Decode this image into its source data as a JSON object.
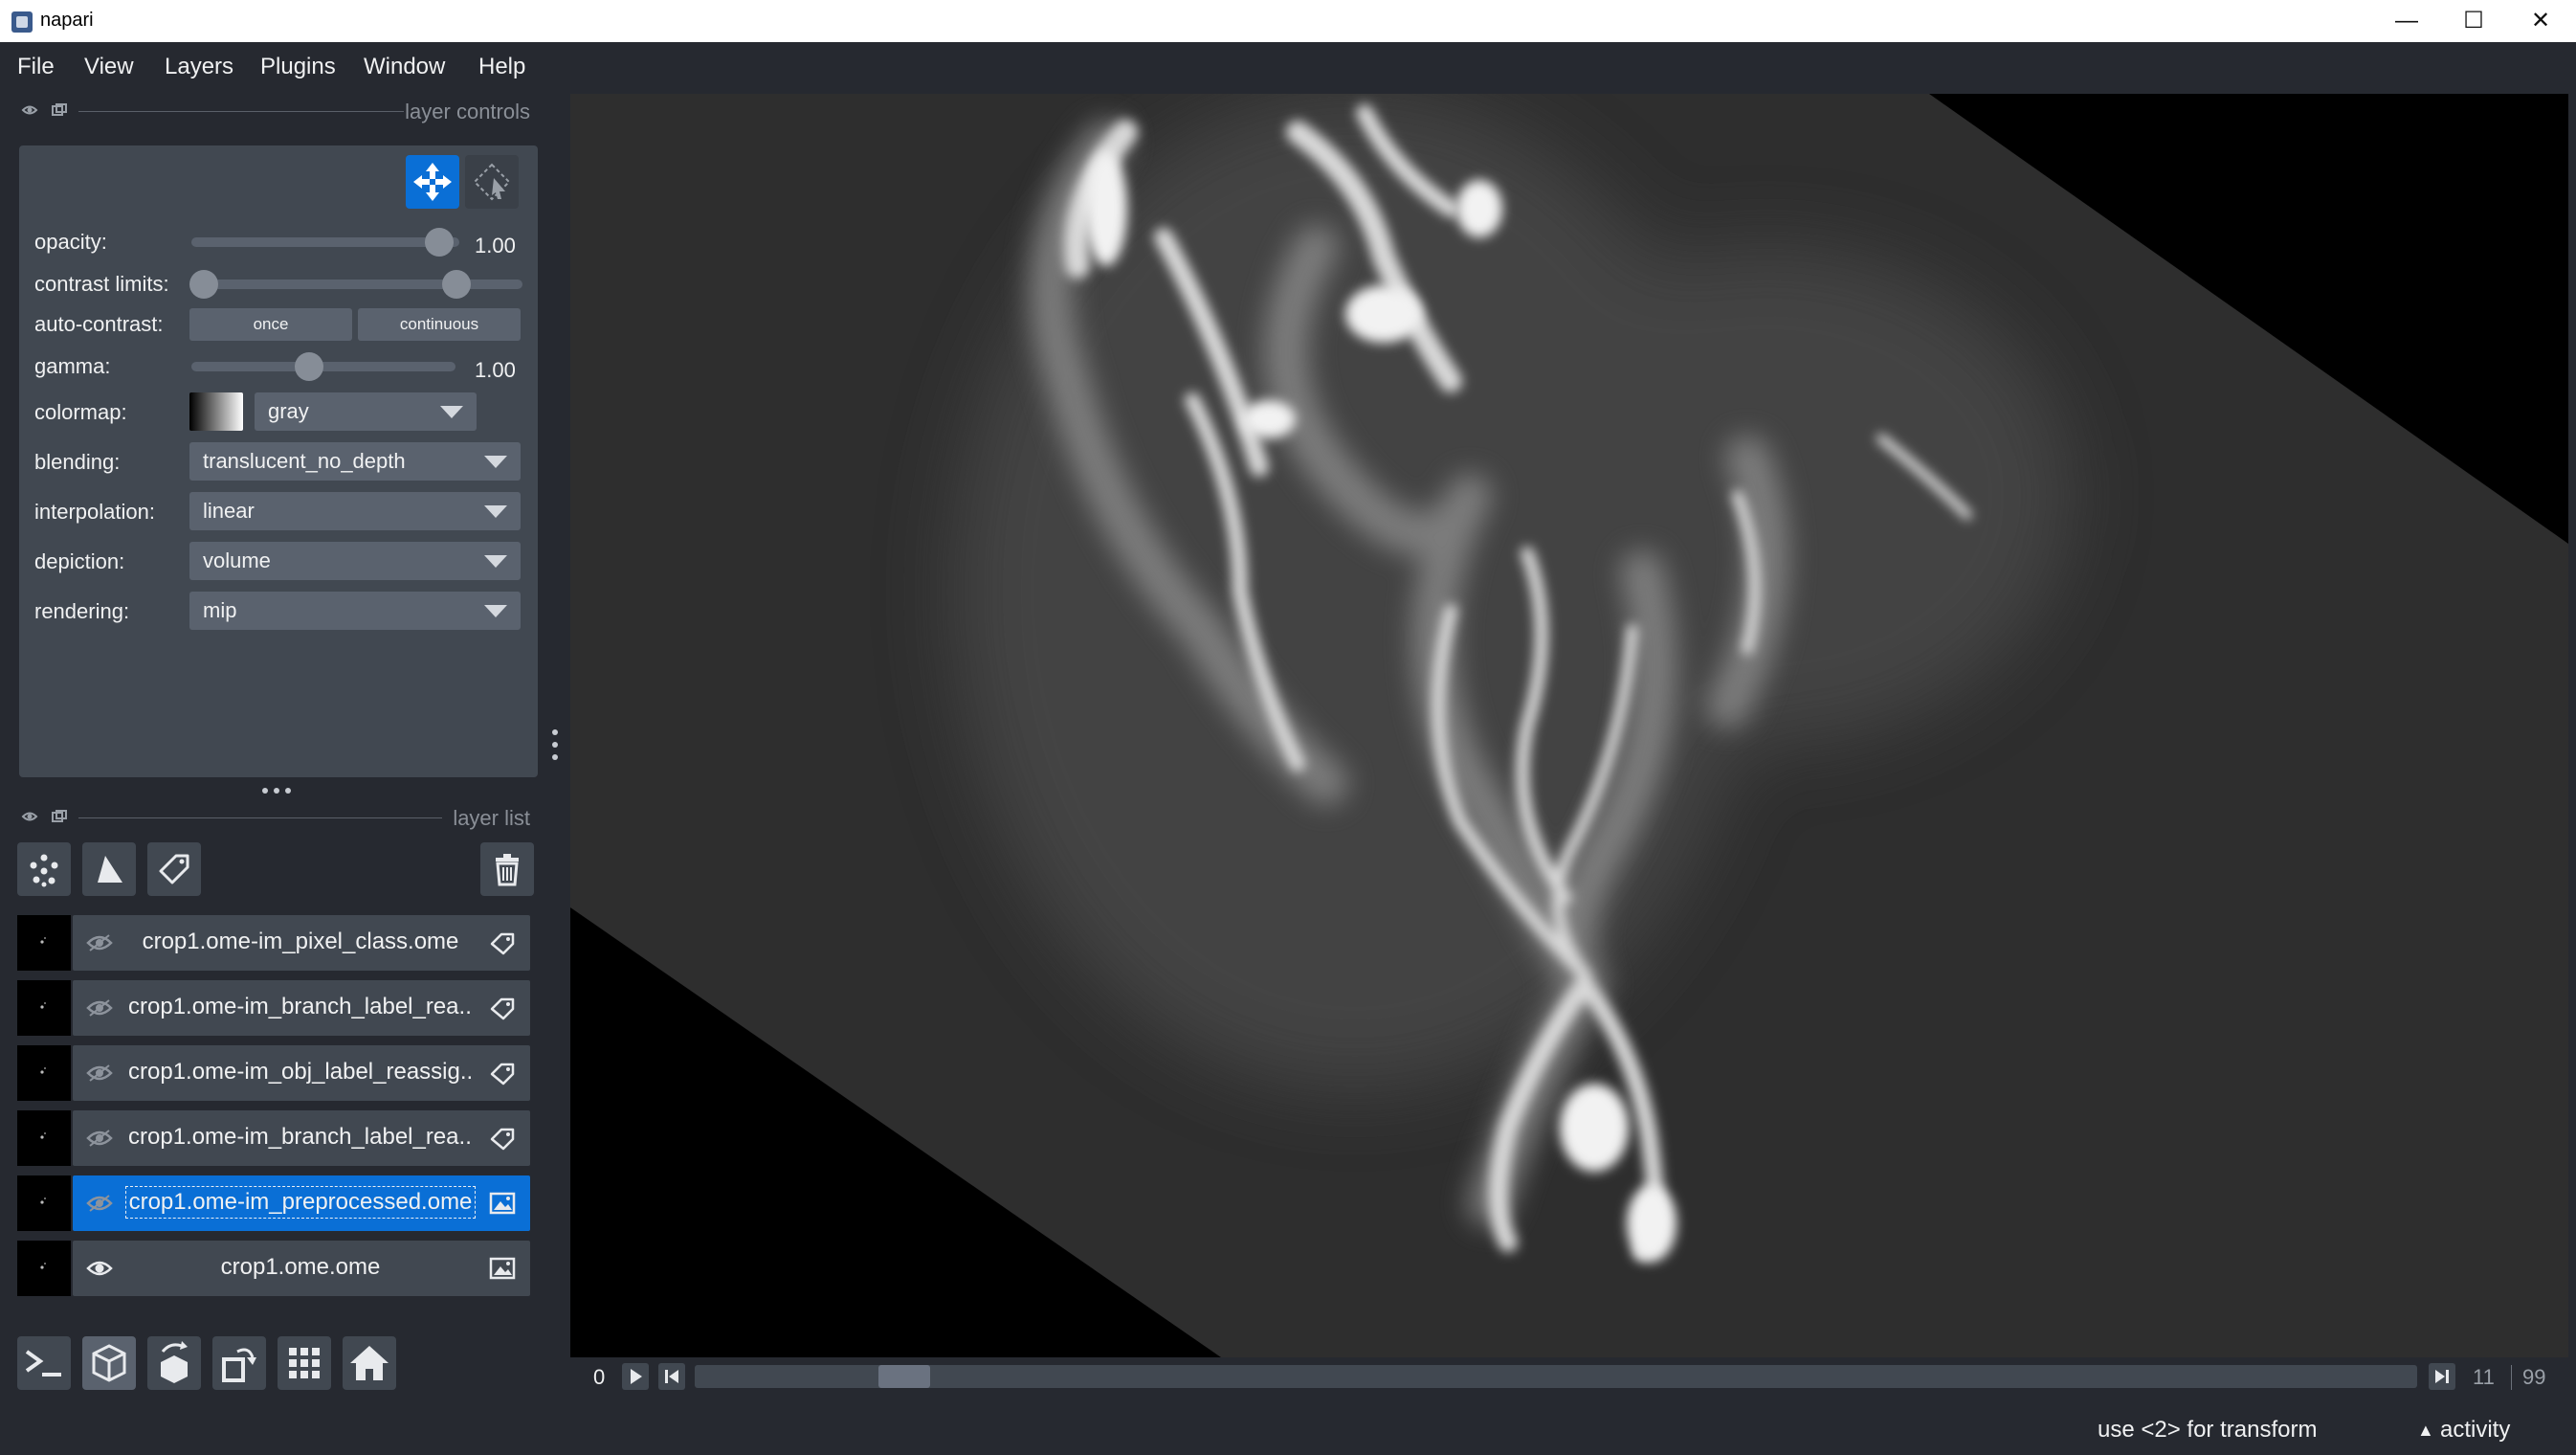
{
  "window": {
    "title": "napari",
    "minimize": "—",
    "maximize": "☐",
    "close": "✕"
  },
  "menu": [
    "File",
    "View",
    "Layers",
    "Plugins",
    "Window",
    "Help"
  ],
  "layer_controls": {
    "header": "layer controls",
    "opacity": {
      "label": "opacity:",
      "value": "1.00",
      "fraction": 1.0
    },
    "contrast_limits": {
      "label": "contrast limits:",
      "low_fraction": 0.0,
      "high_fraction": 0.82
    },
    "auto_contrast": {
      "label": "auto-contrast:",
      "once": "once",
      "continuous": "continuous"
    },
    "gamma": {
      "label": "gamma:",
      "value": "1.00",
      "fraction": 0.45
    },
    "colormap": {
      "label": "colormap:",
      "value": "gray"
    },
    "blending": {
      "label": "blending:",
      "value": "translucent_no_depth"
    },
    "interpolation": {
      "label": "interpolation:",
      "value": "linear"
    },
    "depiction": {
      "label": "depiction:",
      "value": "volume"
    },
    "rendering": {
      "label": "rendering:",
      "value": "mip"
    }
  },
  "layer_list": {
    "header": "layer list",
    "layers": [
      {
        "name": "crop1.ome-im_pixel_class.ome",
        "type": "labels",
        "visible": false,
        "selected": false
      },
      {
        "name": "crop1.ome-im_branch_label_rea...",
        "type": "labels",
        "visible": false,
        "selected": false
      },
      {
        "name": "crop1.ome-im_obj_label_reassig...",
        "type": "labels",
        "visible": false,
        "selected": false
      },
      {
        "name": "crop1.ome-im_branch_label_rea...",
        "type": "labels",
        "visible": false,
        "selected": false
      },
      {
        "name": "crop1.ome-im_preprocessed.ome",
        "type": "image",
        "visible": false,
        "selected": true
      },
      {
        "name": "crop1.ome.ome",
        "type": "image",
        "visible": true,
        "selected": false
      }
    ]
  },
  "dims": {
    "axis": "0",
    "current": "11",
    "max": "99",
    "position_fraction": 0.11
  },
  "status": {
    "message": "use <2> for transform",
    "activity": "activity"
  },
  "colors": {
    "background": "#262930",
    "panel": "#414851",
    "accent": "#0a6fd6"
  }
}
